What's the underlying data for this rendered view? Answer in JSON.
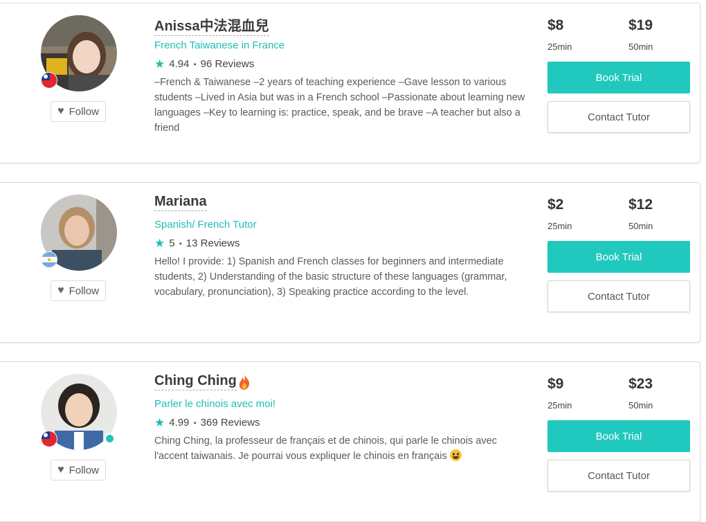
{
  "tutors": [
    {
      "name": "Anissa中法混血兒",
      "subtitle": "French Taiwanese in France",
      "rating": "4.94",
      "reviews": "96 Reviews",
      "bio": "–French & Taiwanese –2 years of teaching experience –Gave lesson to various students –Lived in Asia but was in a French school –Passionate about learning new languages –Key to learning is: practice, speak, and be brave –A teacher but also a friend",
      "flag": "taiwan-flag-icon",
      "follow_label": "Follow",
      "price_short": "$8",
      "duration_short": "25min",
      "price_long": "$19",
      "duration_long": "50min",
      "book_label": "Book Trial",
      "contact_label": "Contact Tutor"
    },
    {
      "name": "Mariana",
      "subtitle": "Spanish/ French Tutor",
      "rating": "5",
      "reviews": "13 Reviews",
      "bio": "Hello! I provide: 1) Spanish and French classes for beginners and intermediate students, 2) Understanding of the basic structure of these languages (grammar, vocabulary, pronunciation), 3) Speaking practice according to the level.",
      "flag": "argentina-flag-icon",
      "follow_label": "Follow",
      "price_short": "$2",
      "duration_short": "25min",
      "price_long": "$12",
      "duration_long": "50min",
      "book_label": "Book Trial",
      "contact_label": "Contact Tutor"
    },
    {
      "name": "Ching Ching",
      "subtitle": "Parler le chinois avec moi!",
      "rating": "4.99",
      "reviews": "369 Reviews",
      "bio": "Ching Ching, la professeur de français et de chinois, qui parle le chinois avec l'accent taiwanais. Je pourrai vous expliquer le chinois en français",
      "flag": "taiwan-flag-icon",
      "follow_label": "Follow",
      "price_short": "$9",
      "duration_short": "25min",
      "price_long": "$23",
      "duration_long": "50min",
      "book_label": "Book Trial",
      "contact_label": "Contact Tutor"
    }
  ],
  "colors": {
    "accent": "#21c8bd",
    "accent_text": "#1fbdb6",
    "online": "#22c3b8"
  }
}
